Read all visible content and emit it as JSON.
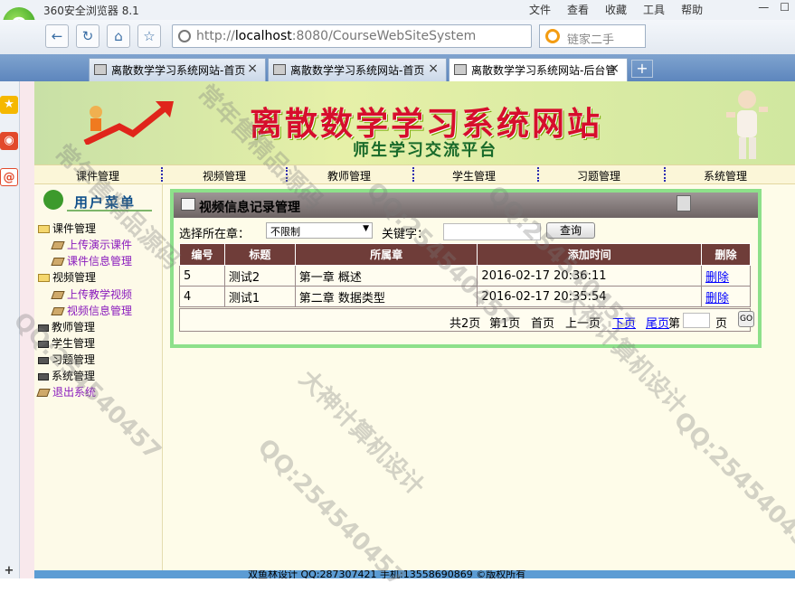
{
  "browser": {
    "app_name": "360安全浏览器 8.1",
    "menus": [
      "文件",
      "查看",
      "收藏",
      "工具",
      "帮助"
    ],
    "address_prefix": "http://",
    "address_host": "localhost",
    "address_rest": ":8080/CourseWebSiteSystem",
    "search_placeholder": "链家二手",
    "tabs": [
      {
        "label": "离散数学学习系统网站-首页"
      },
      {
        "label": "离散数学学习系统网站-首页"
      },
      {
        "label": "离散数学学习系统网站-后台管"
      }
    ]
  },
  "site": {
    "title": "离散数学学习系统网站",
    "subtitle": "师生学习交流平台",
    "nav": [
      "课件管理",
      "视频管理",
      "教师管理",
      "学生管理",
      "习题管理",
      "系统管理"
    ]
  },
  "sidebar": {
    "heading": "用户菜单",
    "items": [
      {
        "label": "课件管理"
      },
      {
        "label": "上传演示课件"
      },
      {
        "label": "课件信息管理"
      },
      {
        "label": "视频管理"
      },
      {
        "label": "上传教学视频"
      },
      {
        "label": "视频信息管理"
      },
      {
        "label": "教师管理"
      },
      {
        "label": "学生管理"
      },
      {
        "label": "习题管理"
      },
      {
        "label": "系统管理"
      },
      {
        "label": "退出系统"
      }
    ]
  },
  "panel": {
    "title": "视频信息记录管理",
    "chapter_label": "选择所在章：",
    "chapter_value": "不限制",
    "keyword_label": "关键字：",
    "query_button": "查询",
    "columns": [
      "编号",
      "标题",
      "所属章",
      "添加时间",
      "删除"
    ],
    "rows": [
      {
        "id": "5",
        "title": "测试2",
        "chapter": "第一章 概述",
        "time": "2016-02-17 20:36:11",
        "action": "删除"
      },
      {
        "id": "4",
        "title": "测试1",
        "chapter": "第二章 数据类型",
        "time": "2016-02-17 20:35:54",
        "action": "删除"
      }
    ],
    "pager": {
      "total": "共2页",
      "current": "第1页",
      "first": "首页",
      "prev": "上一页",
      "next": "下页",
      "last": "尾页",
      "goto_prefix": "第",
      "goto_suffix": "页",
      "go": "GO"
    }
  },
  "footer": {
    "text": "双鱼林设计 QQ:287307421 手机:13558690869 ©版权所有"
  },
  "watermarks": [
    "常年售精品源码",
    "QQ:254540457",
    "大神计算机设计"
  ]
}
